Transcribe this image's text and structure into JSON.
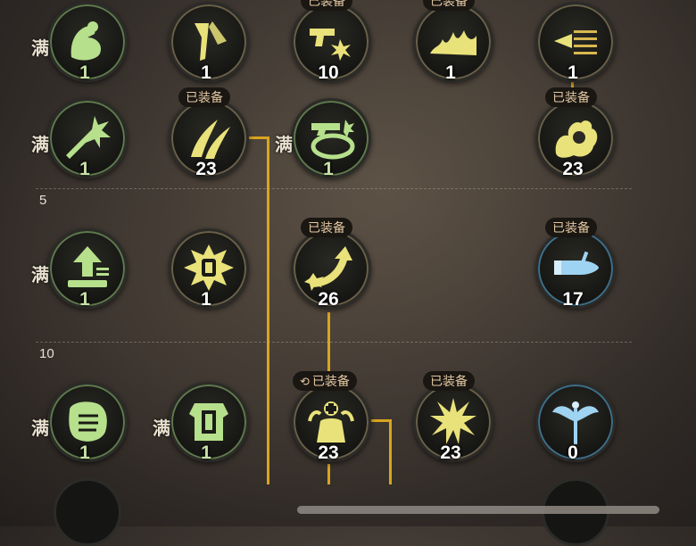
{
  "equipped_label": "已装备",
  "max_label": "满",
  "tiers": [
    {
      "label": "5"
    },
    {
      "label": "10"
    }
  ],
  "colors": {
    "accent": "#d9a520",
    "icon_yellow": "#e9e27a",
    "icon_green": "#b6e08c",
    "icon_blue": "#9fd3f2"
  },
  "skills": [
    {
      "id": "r1c1",
      "icon": "muscle-arm-icon",
      "level": "1",
      "maxed": true,
      "equipped": false
    },
    {
      "id": "r1c2",
      "icon": "blade-slash-icon",
      "level": "1",
      "maxed": false,
      "equipped": false
    },
    {
      "id": "r1c3",
      "icon": "pistol-spark-icon",
      "level": "10",
      "maxed": false,
      "equipped": true
    },
    {
      "id": "r1c4",
      "icon": "flame-wave-icon",
      "level": "1",
      "maxed": false,
      "equipped": true
    },
    {
      "id": "r1c5",
      "icon": "bullet-rush-icon",
      "level": "1",
      "maxed": false,
      "equipped": false
    },
    {
      "id": "r2c1",
      "icon": "burst-shot-icon",
      "level": "1",
      "maxed": true,
      "equipped": false
    },
    {
      "id": "r2c2",
      "icon": "twin-claw-icon",
      "level": "23",
      "maxed": false,
      "equipped": true
    },
    {
      "id": "r2c3",
      "icon": "gun-ring-icon",
      "level": "1",
      "maxed": true,
      "equipped": false
    },
    {
      "id": "r2c5",
      "icon": "fire-beast-icon",
      "level": "23",
      "maxed": false,
      "equipped": true
    },
    {
      "id": "r3c1",
      "icon": "up-arrow-icon",
      "level": "1",
      "maxed": true,
      "equipped": false
    },
    {
      "id": "r3c2",
      "icon": "bullet-burst-icon",
      "level": "1",
      "maxed": false,
      "equipped": false
    },
    {
      "id": "r3c3",
      "icon": "curve-arrow-icon",
      "level": "26",
      "maxed": false,
      "equipped": true
    },
    {
      "id": "r3c5",
      "icon": "bullet-icon",
      "level": "17",
      "maxed": false,
      "equipped": true
    },
    {
      "id": "r4c1",
      "icon": "gauntlet-icon",
      "level": "1",
      "maxed": true,
      "equipped": false
    },
    {
      "id": "r4c2",
      "icon": "armor-icon",
      "level": "1",
      "maxed": true,
      "equipped": false
    },
    {
      "id": "r4c3",
      "icon": "figure-cross-icon",
      "level": "23",
      "maxed": false,
      "equipped": true,
      "swappable": true
    },
    {
      "id": "r4c4",
      "icon": "explosion-icon",
      "level": "23",
      "maxed": false,
      "equipped": true
    },
    {
      "id": "r4c5",
      "icon": "winged-staff-icon",
      "level": "0",
      "maxed": false,
      "equipped": false
    }
  ]
}
